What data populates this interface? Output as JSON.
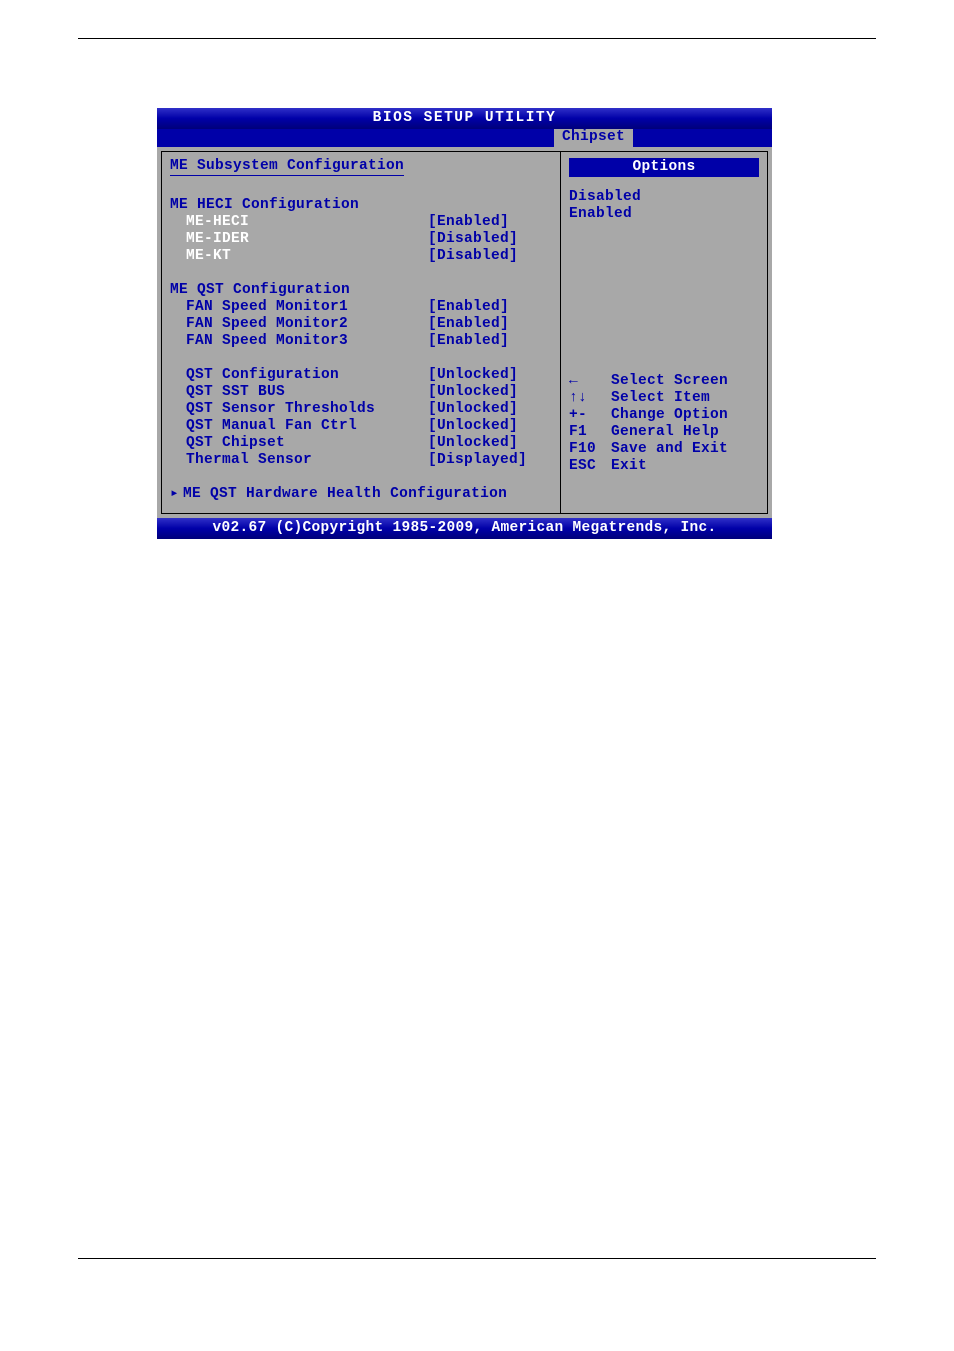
{
  "title": "BIOS SETUP UTILITY",
  "tab": "Chipset",
  "left": {
    "section_title": "ME Subsystem Configuration",
    "heci_header": "ME HECI Configuration",
    "heci": [
      {
        "label": "ME-HECI",
        "value": "[Enabled]",
        "selected": true
      },
      {
        "label": "ME-IDER",
        "value": "[Disabled]",
        "selected": false
      },
      {
        "label": "ME-KT",
        "value": "[Disabled]",
        "selected": false
      }
    ],
    "qst_header": "ME QST Configuration",
    "qst_fan": [
      {
        "label": "FAN Speed Monitor1",
        "value": "[Enabled]"
      },
      {
        "label": "FAN Speed Monitor2",
        "value": "[Enabled]"
      },
      {
        "label": "FAN Speed Monitor3",
        "value": "[Enabled]"
      }
    ],
    "qst_cfg": [
      {
        "label": "QST Configuration",
        "value": "[Unlocked]"
      },
      {
        "label": "QST SST BUS",
        "value": "[Unlocked]"
      },
      {
        "label": "QST Sensor Thresholds",
        "value": "[Unlocked]"
      },
      {
        "label": "QST Manual Fan Ctrl",
        "value": "[Unlocked]"
      },
      {
        "label": "QST Chipset",
        "value": "[Unlocked]"
      },
      {
        "label": "Thermal Sensor",
        "value": "[Displayed]"
      }
    ],
    "submenu": "ME QST Hardware Health Configuration"
  },
  "right": {
    "options_hdr": "Options",
    "options": [
      "Disabled",
      "Enabled"
    ],
    "help": [
      {
        "key": "←",
        "text": "Select Screen"
      },
      {
        "key": "↑↓",
        "text": "Select Item"
      },
      {
        "key": "+-",
        "text": "Change Option"
      },
      {
        "key": "F1",
        "text": "General Help"
      },
      {
        "key": "F10",
        "text": "Save and Exit"
      },
      {
        "key": "ESC",
        "text": "Exit"
      }
    ]
  },
  "footer": "v02.67 (C)Copyright 1985-2009, American Megatrends, Inc."
}
